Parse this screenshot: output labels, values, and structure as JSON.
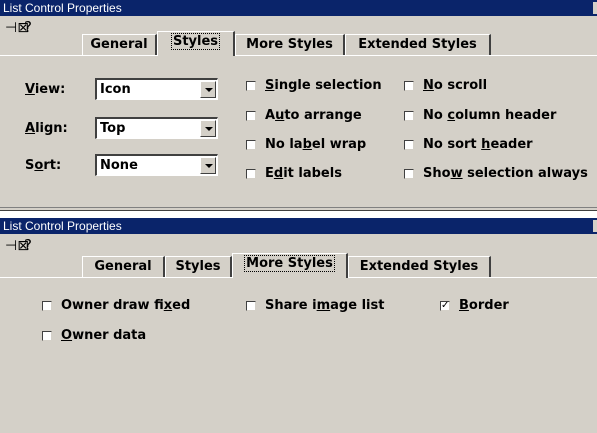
{
  "dialog1": {
    "title": "List Control Properties",
    "tabs": {
      "general": "General",
      "styles": "Styles",
      "more_styles": "More Styles",
      "extended_styles": "Extended Styles"
    },
    "view": {
      "pre": "",
      "accel": "V",
      "post": "iew:",
      "value": "Icon"
    },
    "align": {
      "pre": "",
      "accel": "A",
      "post": "lign:",
      "value": "Top"
    },
    "sort": {
      "pre": "S",
      "accel": "o",
      "post": "rt:",
      "value": "None"
    },
    "checks": {
      "single_selection": {
        "pre": "",
        "accel": "S",
        "post": "ingle selection",
        "checked": false
      },
      "auto_arrange": {
        "pre": "A",
        "accel": "u",
        "post": "to arrange",
        "checked": false
      },
      "no_label_wrap": {
        "pre": "No la",
        "accel": "b",
        "post": "el wrap",
        "checked": false
      },
      "edit_labels": {
        "pre": "E",
        "accel": "d",
        "post": "it labels",
        "checked": false
      },
      "no_scroll": {
        "pre": "",
        "accel": "N",
        "post": "o scroll",
        "checked": false
      },
      "no_column_header": {
        "pre": "No ",
        "accel": "c",
        "post": "olumn header",
        "checked": false
      },
      "no_sort_header": {
        "pre": "No sort ",
        "accel": "h",
        "post": "eader",
        "checked": false
      },
      "show_selection_always": {
        "pre": "Sho",
        "accel": "w",
        "post": " selection always",
        "checked": false
      }
    }
  },
  "dialog2": {
    "title": "List Control Properties",
    "tabs": {
      "general": "General",
      "styles": "Styles",
      "more_styles": "More Styles",
      "extended_styles": "Extended Styles"
    },
    "checks": {
      "owner_draw_fixed": {
        "pre": "Owner draw fi",
        "accel": "x",
        "post": "ed",
        "checked": false
      },
      "owner_data": {
        "pre": "",
        "accel": "O",
        "post": "wner data",
        "checked": false
      },
      "share_image_list": {
        "pre": "Share i",
        "accel": "m",
        "post": "age list",
        "checked": false
      },
      "border": {
        "pre": "",
        "accel": "B",
        "post": "order",
        "checked": true
      }
    }
  },
  "icons": {
    "pin": "pushpin-icon",
    "help": "question-mark-icon",
    "dropdown": "chevron-down-icon",
    "check": "checkmark-icon"
  },
  "glyphs": {
    "pin": "⊣⊠",
    "help": "?",
    "check": "✓"
  }
}
